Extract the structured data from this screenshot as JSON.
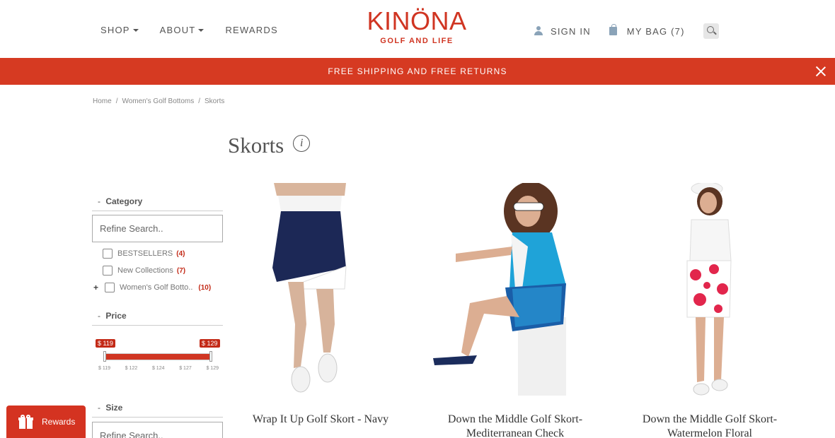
{
  "header": {
    "nav_left": [
      {
        "label": "SHOP",
        "has_dropdown": true
      },
      {
        "label": "ABOUT",
        "has_dropdown": true
      },
      {
        "label": "REWARDS",
        "has_dropdown": false
      }
    ],
    "logo": {
      "word": "KINÖNA",
      "tagline": "GOLF AND LIFE",
      "dots": "● ● ●"
    },
    "sign_in": "SIGN IN",
    "bag": "MY BAG (7)"
  },
  "banner": {
    "text": "FREE SHIPPING AND FREE RETURNS"
  },
  "breadcrumb": [
    "Home",
    "Women's Golf Bottoms",
    "Skorts"
  ],
  "page": {
    "title": "Skorts",
    "info_glyph": "i"
  },
  "filters": {
    "category": {
      "title": "Category",
      "search_placeholder": "Refine Search..",
      "items": [
        {
          "label": "BESTSELLERS",
          "count": "(4)"
        },
        {
          "label": "New Collections",
          "count": "(7)"
        },
        {
          "label": "Women's Golf Botto..",
          "count": "(10)",
          "expandable": true
        }
      ]
    },
    "price": {
      "title": "Price",
      "min_label": "$ 119",
      "max_label": "$ 129",
      "min": 119,
      "max": 129,
      "ticks": [
        "$ 119",
        "$ 122",
        "$ 124",
        "$ 127",
        "$ 129"
      ]
    },
    "size": {
      "title": "Size",
      "search_placeholder": "Refine Search.."
    }
  },
  "products": [
    {
      "name": "Wrap It Up Golf Skort - Navy"
    },
    {
      "name": "Down the Middle Golf Skort-Mediterranean Check"
    },
    {
      "name": "Down the Middle Golf Skort-Watermelon Floral"
    }
  ],
  "rewards_button": {
    "label": "Rewards"
  },
  "colors": {
    "brand_red": "#d03522",
    "banner_red": "#d63a22",
    "count_red": "#c32a17",
    "icon_blue": "#8aa3b8"
  }
}
